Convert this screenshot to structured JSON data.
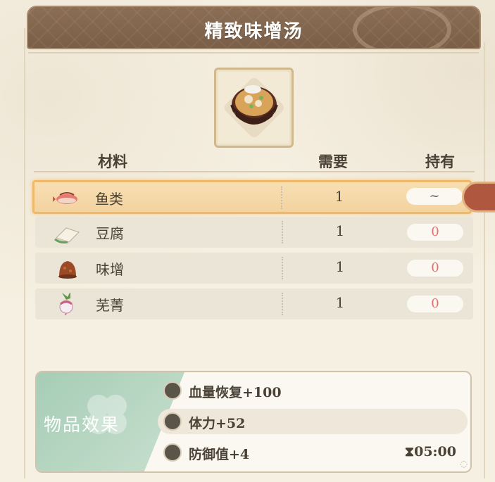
{
  "title": "精致味增汤",
  "table": {
    "headers": {
      "material": "材料",
      "need": "需要",
      "have": "持有"
    },
    "rows": [
      {
        "name": "鱼类",
        "need": "1",
        "have": "~",
        "icon": "fish-icon",
        "selected": true
      },
      {
        "name": "豆腐",
        "need": "1",
        "have": "0",
        "icon": "tofu-icon",
        "selected": false
      },
      {
        "name": "味增",
        "need": "1",
        "have": "0",
        "icon": "miso-icon",
        "selected": false
      },
      {
        "name": "芜菁",
        "need": "1",
        "have": "0",
        "icon": "turnip-icon",
        "selected": false
      }
    ]
  },
  "effects": {
    "label": "物品效果",
    "items": [
      {
        "text": "血量恢复+100",
        "icon": "hp-icon"
      },
      {
        "text": "体力+52",
        "icon": "stamina-icon"
      },
      {
        "text": "防御值+4",
        "icon": "defense-icon"
      }
    ],
    "duration": "05:00"
  },
  "colors": {
    "banner": "#8b6e55",
    "selected_row": "#f3d39f",
    "have_zero": "#e07070",
    "effects_green": "#a6cdb6",
    "tab_tag": "#b0583f"
  }
}
